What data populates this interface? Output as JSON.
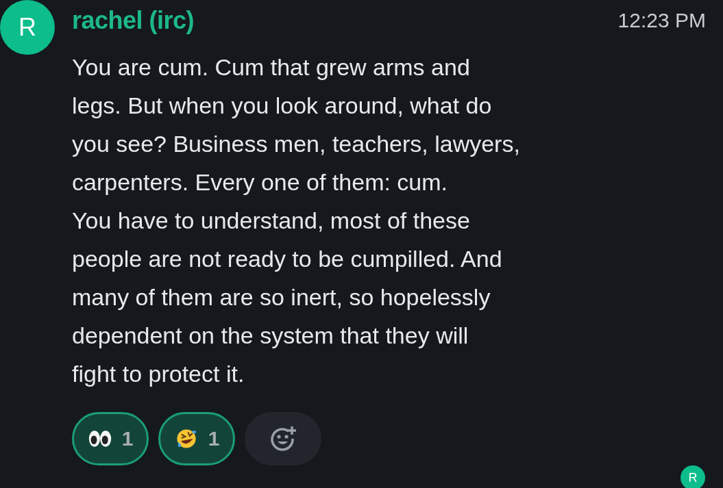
{
  "message": {
    "avatar_initial": "R",
    "sender": "rachel (irc)",
    "time": "12:23 PM",
    "paragraphs": [
      [
        "You are cum. Cum that grew arms and",
        "legs. But when you look around, what do",
        "you see? Business men, teachers, lawyers,",
        "carpenters. Every one of them: cum."
      ],
      [
        "You have to understand, most of these",
        "people are not ready to be cumpilled. And",
        "many of them are so inert, so hopelessly",
        "dependent on the system that they will",
        "fight to protect it."
      ]
    ],
    "reactions": [
      {
        "kind": "eyes",
        "count": "1",
        "selected": true
      },
      {
        "kind": "laughing",
        "count": "1",
        "selected": true
      }
    ],
    "read_receipt": {
      "initial": "R"
    }
  }
}
